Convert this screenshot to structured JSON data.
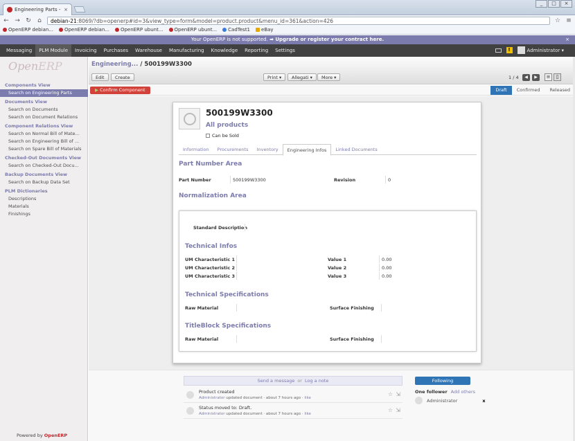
{
  "browser": {
    "tab_title": "Engineering Parts - Op",
    "tab_close": "×",
    "url_host": "debian-21",
    "url_rest": ":8069/?db=openerp#id=3&view_type=form&model=product.product&menu_id=361&action=426",
    "window_buttons": [
      "_",
      "□",
      "×"
    ],
    "bookmarks": [
      "OpenERP debian...",
      "OpenERP debian...",
      "OpenERP ubunt...",
      "OpenERP ubunt...",
      "CadTest1",
      "eBay"
    ]
  },
  "notice": {
    "text": "Your OpenERP is not supported.",
    "link": "➡ Upgrade or register your contract here.",
    "close": "×"
  },
  "topmenu": {
    "items": [
      "Messaging",
      "PLM Module",
      "Invoicing",
      "Purchases",
      "Warehouse",
      "Manufacturing",
      "Knowledge",
      "Reporting",
      "Settings"
    ],
    "active": "PLM Module",
    "user": "Administrator ▾",
    "warn": "!"
  },
  "sidebar": {
    "logo_open": "Open",
    "logo_erp": "ERP",
    "sections": [
      {
        "title": "Components View",
        "items": [
          "Search on Engineering Parts"
        ]
      },
      {
        "title": "Documents View",
        "items": [
          "Search on Documents",
          "Search on Document Relations"
        ]
      },
      {
        "title": "Component Relations View",
        "items": [
          "Search on Normal Bill of Mate...",
          "Search on Engineering Bill of ...",
          "Search on Spare Bill of Materials"
        ]
      },
      {
        "title": "Checked-Out Documents View",
        "items": [
          "Search on Checked-Out Docu..."
        ]
      },
      {
        "title": "Backup Documents View",
        "items": [
          "Search on Backup Data Set"
        ]
      },
      {
        "title": "PLM Dictionaries",
        "items": [
          "Descriptions",
          "Materials",
          "Finishings"
        ]
      }
    ],
    "powered_by": "Powered by",
    "powered_brand": "OpenERP"
  },
  "header": {
    "breadcrumb_link": "Engineering...",
    "breadcrumb_sep": " / ",
    "breadcrumb_current": "500199W3300",
    "edit": "Edit",
    "create": "Create",
    "print": "Print ▾",
    "allegati": "Allegati ▾",
    "more": "More ▾",
    "pager": "1 / 4",
    "prev": "◀",
    "next": "▶"
  },
  "statusbar": {
    "confirm": "Confirm Component",
    "steps": [
      "Draft",
      "Confirmed",
      "Released"
    ],
    "current": "Draft"
  },
  "form": {
    "name": "500199W3300",
    "category": "All products",
    "can_be_sold_label": "Can be Sold",
    "tabs": [
      "Information",
      "Procurements",
      "Inventory",
      "Engineering Infos",
      "Linked Documents"
    ],
    "active_tab": "Engineering Infos",
    "part_number_area": "Part Number Area",
    "part_number_label": "Part Number",
    "part_number": "500199W3300",
    "revision_label": "Revision",
    "revision": "0",
    "normalization_area": "Normalization Area",
    "standard_description_label": "Standard Description",
    "technical_infos": "Technical Infos",
    "um": [
      "UM Characteristic 1",
      "UM Characteristic 2",
      "UM Characteristic 3"
    ],
    "value_labels": [
      "Value 1",
      "Value 2",
      "Value 3"
    ],
    "values": [
      "0.00",
      "0.00",
      "0.00"
    ],
    "technical_specifications": "Technical Specifications",
    "raw_material_label": "Raw Material",
    "surface_finishing_label": "Surface Finishing",
    "titleblock_specifications": "TitleBlock Specifications"
  },
  "chatter": {
    "send_message": "Send a message",
    "or": "or",
    "log_note": "Log a note",
    "messages": [
      {
        "body": "Product created",
        "author": "Administrator",
        "action": " updated document · about 7 hours ago · ",
        "like": "like"
      },
      {
        "body": "Status moved to: Draft.",
        "author": "Administrator",
        "action": " updated document · about 7 hours ago · ",
        "like": "like"
      }
    ],
    "following": "Following",
    "followers_count": "One follower",
    "add_others": "Add others",
    "follower": "Administrator",
    "remove": "x"
  }
}
